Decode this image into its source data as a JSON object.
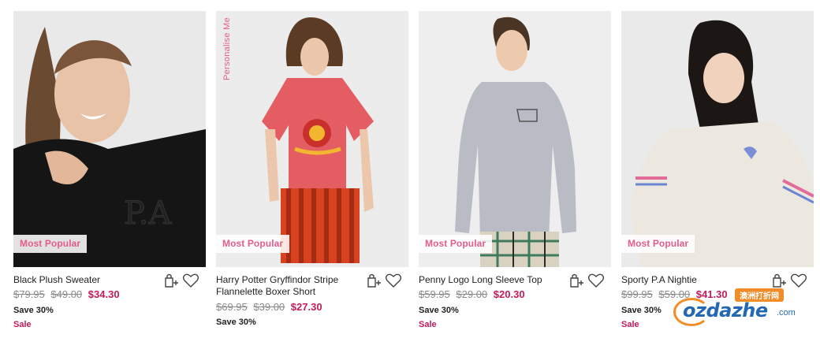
{
  "products": [
    {
      "badge": "Most Popular",
      "name": "Black Plush Sweater",
      "prices": [
        "$79.95",
        "$49.00"
      ],
      "now": "$34.30",
      "save": "Save 30%",
      "sale": "Sale"
    },
    {
      "personalise": "Personalise Me",
      "badge": "Most Popular",
      "name": "Harry Potter Gryffindor Stripe Flannelette Boxer Short",
      "prices": [
        "$69.95",
        "$39.00"
      ],
      "now": "$27.30",
      "save": "Save 30%"
    },
    {
      "badge": "Most Popular",
      "name": "Penny Logo Long Sleeve Top",
      "prices": [
        "$59.95",
        "$29.00"
      ],
      "now": "$20.30",
      "save": "Save 30%",
      "sale": "Sale"
    },
    {
      "badge": "Most Popular",
      "name": "Sporty P.A Nightie",
      "prices": [
        "$99.95",
        "$59.00"
      ],
      "now": "$41.30",
      "save": "Save 30%",
      "sale": "Sale"
    }
  ],
  "icons": {
    "bag": "add-to-bag-icon",
    "wishlist": "heart-icon"
  },
  "watermark": {
    "brand": "ozdazhe",
    "domain": ".com",
    "badge": "澳洲打折网"
  },
  "colors": {
    "accent": "#e55c8a",
    "price": "#c01c5a",
    "strike": "#8a8a8a"
  }
}
